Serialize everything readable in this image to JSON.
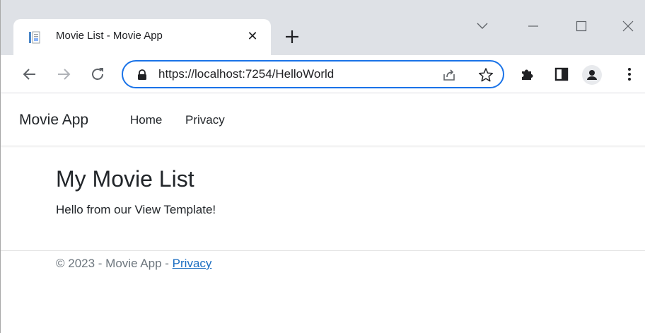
{
  "browser": {
    "tab": {
      "title": "Movie List - Movie App",
      "close_glyph": "✕"
    },
    "new_tab_glyph": "+",
    "url": "https://localhost:7254/HelloWorld",
    "icons": {
      "favicon": "page-favicon-icon",
      "back": "back-arrow-icon",
      "forward": "forward-arrow-icon",
      "reload": "reload-icon",
      "lock": "lock-icon",
      "share": "share-icon",
      "bookmark": "star-icon",
      "extensions": "puzzle-icon",
      "side_panel": "side-panel-icon",
      "profile": "profile-icon",
      "menu": "kebab-menu-icon",
      "tab_search": "chevron-down-icon",
      "minimize": "minimize-icon",
      "maximize": "maximize-icon",
      "close_window": "close-icon"
    },
    "accent_color": "#1a73e8"
  },
  "site": {
    "brand": "Movie App",
    "nav": [
      {
        "label": "Home"
      },
      {
        "label": "Privacy"
      }
    ],
    "heading": "My Movie List",
    "message": "Hello from our View Template!",
    "footer": {
      "prefix": "© 2023 - Movie App - ",
      "link": "Privacy"
    },
    "link_color": "#1b6ec2"
  }
}
